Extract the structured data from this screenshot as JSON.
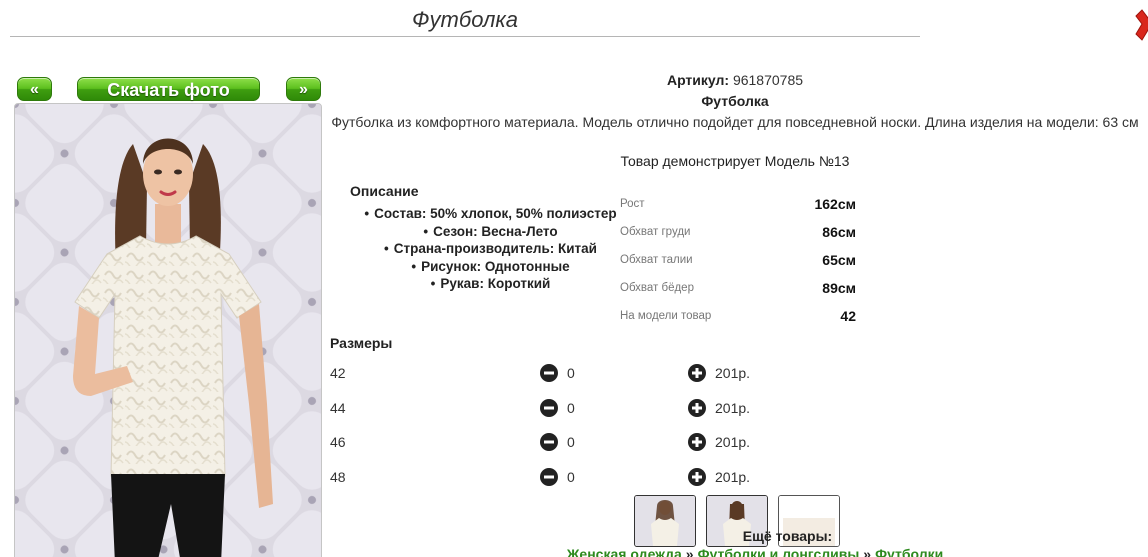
{
  "header": {
    "title": "Футболка"
  },
  "gallery": {
    "prev_label": "«",
    "next_label": "»",
    "download_label": "Скачать фото"
  },
  "product": {
    "article_label": "Артикул:",
    "article_value": "961870785",
    "name": "Футболка",
    "description": "Футболка из комфортного материала. Модель отлично подойдет для повседневной носки. Длина изделия на модели: 63 см",
    "model_note": "Товар демонстрирует Модель №13"
  },
  "specs": {
    "title": "Описание",
    "items": [
      "Состав: 50% хлопок, 50% полиэстер",
      "Сезон: Весна-Лето",
      "Страна-производитель: Китай",
      "Рисунок: Однотонные",
      "Рукав: Короткий"
    ]
  },
  "measurements": [
    {
      "label": "Рост",
      "value": "162см"
    },
    {
      "label": "Обхват груди",
      "value": "86см"
    },
    {
      "label": "Обхват талии",
      "value": "65см"
    },
    {
      "label": "Обхват бёдер",
      "value": "89см"
    },
    {
      "label": "На модели товар",
      "value": "42"
    }
  ],
  "sizes": {
    "title": "Размеры",
    "rows": [
      {
        "size": "42",
        "qty": "0",
        "price": "201р."
      },
      {
        "size": "44",
        "qty": "0",
        "price": "201р."
      },
      {
        "size": "46",
        "qty": "0",
        "price": "201р."
      },
      {
        "size": "48",
        "qty": "0",
        "price": "201р."
      }
    ]
  },
  "more": {
    "title": "Ещё товары:",
    "breadcrumb": [
      "Женская одежда",
      "Футболки и лонгсливы",
      "Футболки"
    ],
    "separator": "»"
  },
  "colors": {
    "button_green": "#4caf1a",
    "link_green": "#2d8a1e",
    "close_red": "#d9261c"
  },
  "icons": {
    "close": "close-x-icon",
    "minus": "minus-circle-icon",
    "plus": "plus-circle-icon"
  }
}
